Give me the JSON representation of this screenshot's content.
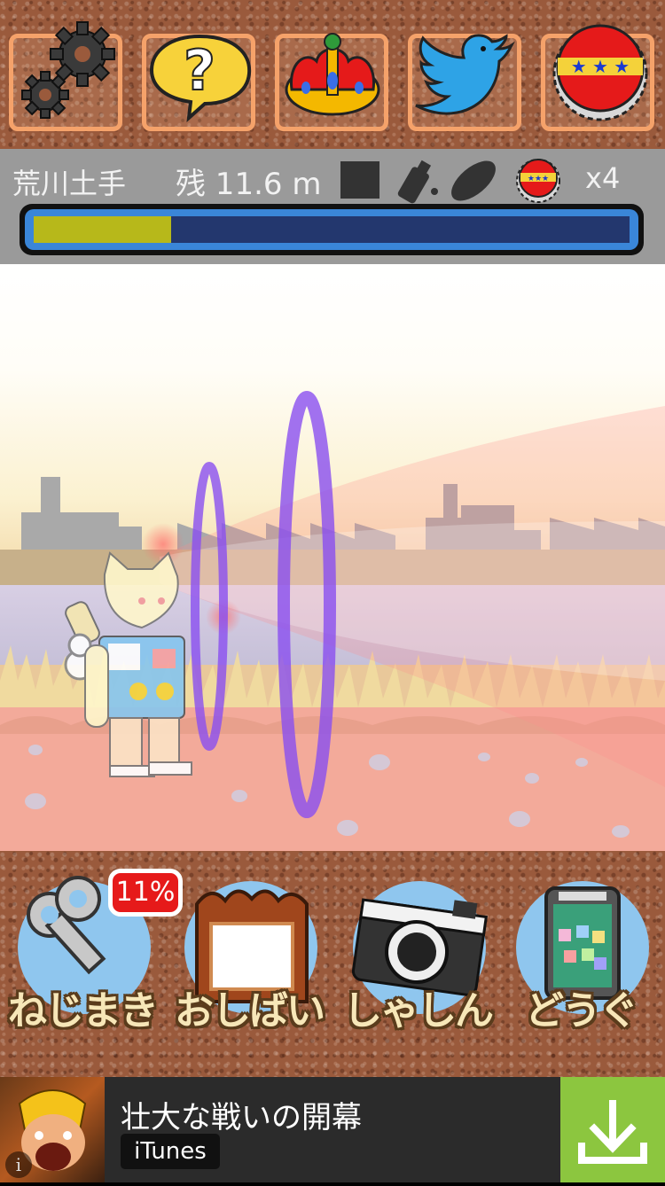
{
  "top_buttons": [
    {
      "name": "settings",
      "icon": "gears-icon"
    },
    {
      "name": "help",
      "icon": "question-bubble-icon"
    },
    {
      "name": "ranking",
      "icon": "crown-icon"
    },
    {
      "name": "twitter",
      "icon": "twitter-bird-icon"
    },
    {
      "name": "bottlecap",
      "icon": "bottlecap-icon"
    }
  ],
  "status": {
    "location": "荒川土手",
    "remaining": "残 11.6 m",
    "items": [
      "square-item-icon",
      "spray-item-icon",
      "sole-item-icon"
    ],
    "cap_count": "x4",
    "progress_fraction": 0.23
  },
  "actions": [
    {
      "label": "ねじまき",
      "icon": "windup-key-icon",
      "badge": "11%"
    },
    {
      "label": "おしばい",
      "icon": "picture-frame-icon"
    },
    {
      "label": "しゃしん",
      "icon": "camera-icon"
    },
    {
      "label": "どうぐ",
      "icon": "phone-tools-icon"
    }
  ],
  "ad": {
    "title": "壮大な戦いの開幕",
    "store": "iTunes",
    "info": "i"
  },
  "colors": {
    "progress_fill": "#b7b81a",
    "progress_track": "#23376e",
    "button_border": "#f5a26a",
    "badge": "#e61a1a",
    "ad_download": "#8cc63f"
  }
}
